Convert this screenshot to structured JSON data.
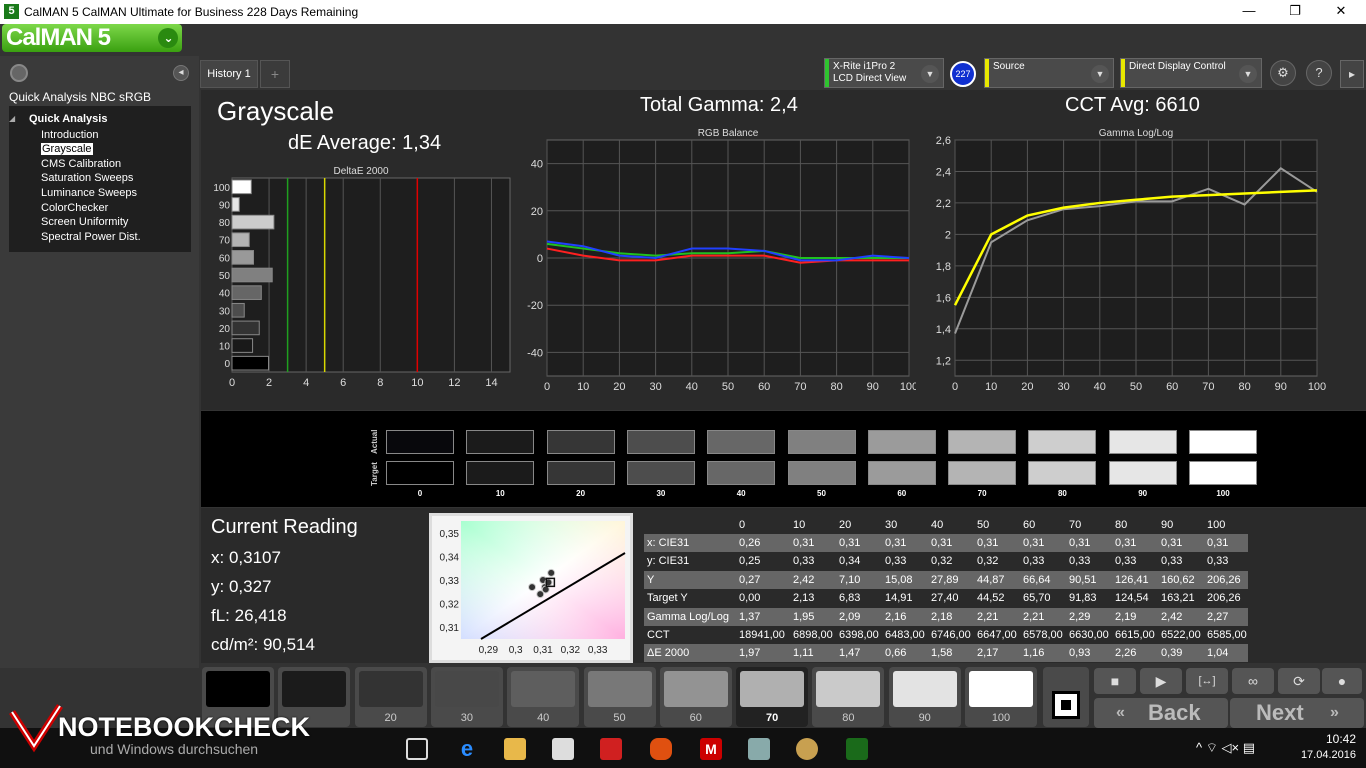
{
  "window": {
    "app_icon": "5",
    "title": "CalMAN 5 CalMAN Ultimate for Business 228 Days Remaining",
    "min": "—",
    "max": "❐",
    "close": "✕"
  },
  "logo": {
    "text": "CalMAN 5",
    "dropdown": "⌄"
  },
  "sidebar": {
    "collapse": "◂",
    "title": "Quick Analysis NBC sRGB",
    "root": "Quick Analysis",
    "items": [
      "Introduction",
      "Grayscale",
      "CMS Calibration",
      "Saturation Sweeps",
      "Luminance Sweeps",
      "ColorChecker",
      "Screen Uniformity",
      "Spectral Power Dist."
    ]
  },
  "tabs": {
    "history": "History 1",
    "add": "+"
  },
  "devices": {
    "meter_line1": "X-Rite i1Pro 2",
    "meter_line2": "LCD Direct View",
    "badge": "227",
    "source": "Source",
    "display": "Direct Display Control",
    "gear": "⚙",
    "help": "?",
    "collapse": "▸"
  },
  "colors": {
    "meter": "#2fc42f",
    "source": "#e8e800",
    "display": "#e8e800",
    "yellow_curve": "#ffff00",
    "gray_curve": "#9a9a9a"
  },
  "header": {
    "title": "Grayscale",
    "de_avg": "dE Average: 1,34",
    "gamma": "Total Gamma: 2,4",
    "cct": "CCT Avg: 6610"
  },
  "chart_data": [
    {
      "type": "bar",
      "title": "DeltaE 2000",
      "orientation": "horizontal",
      "categories": [
        "100",
        "90",
        "80",
        "70",
        "60",
        "50",
        "40",
        "30",
        "20",
        "10",
        "0"
      ],
      "values": [
        1.04,
        0.39,
        2.26,
        0.93,
        1.16,
        2.17,
        1.58,
        0.66,
        1.47,
        1.11,
        1.97
      ],
      "xlim": [
        0,
        15
      ],
      "xticks": [
        "0",
        "2",
        "4",
        "6",
        "8",
        "10",
        "12",
        "14"
      ],
      "threshold_lines": [
        {
          "x": 3,
          "color": "#1fa01f"
        },
        {
          "x": 5,
          "color": "#d8d800"
        },
        {
          "x": 10,
          "color": "#e00000"
        }
      ]
    },
    {
      "type": "line",
      "title": "RGB Balance",
      "x": [
        0,
        10,
        20,
        30,
        40,
        50,
        60,
        70,
        80,
        90,
        100
      ],
      "ylim": [
        -50,
        50
      ],
      "yticks": [
        "40",
        "20",
        "0",
        "-20",
        "-40"
      ],
      "xticks": [
        "0",
        "10",
        "20",
        "30",
        "40",
        "50",
        "60",
        "70",
        "80",
        "90",
        "100"
      ],
      "series": [
        {
          "color": "#ff2020",
          "values": [
            4,
            1,
            -1,
            -1,
            1,
            1,
            1,
            -2,
            -1,
            -1,
            -1
          ]
        },
        {
          "color": "#20c020",
          "values": [
            6,
            4,
            2,
            1,
            2,
            2,
            3,
            0,
            0,
            0,
            0
          ]
        },
        {
          "color": "#2040ff",
          "values": [
            7,
            5,
            1,
            0,
            4,
            4,
            3,
            -1,
            -1,
            1,
            0
          ]
        }
      ]
    },
    {
      "type": "line",
      "title": "Gamma Log/Log",
      "x": [
        0,
        10,
        20,
        30,
        40,
        50,
        60,
        70,
        80,
        90,
        100
      ],
      "ylim": [
        1.1,
        2.6
      ],
      "yticks": [
        "2,6",
        "2,4",
        "2,2",
        "2",
        "1,8",
        "1,6",
        "1,4",
        "1,2"
      ],
      "xticks": [
        "0",
        "10",
        "20",
        "30",
        "40",
        "50",
        "60",
        "70",
        "80",
        "90",
        "100"
      ],
      "series": [
        {
          "color": "#9a9a9a",
          "values": [
            1.37,
            1.95,
            2.09,
            2.16,
            2.18,
            2.21,
            2.21,
            2.29,
            2.19,
            2.42,
            2.27
          ]
        },
        {
          "color": "#ffff00",
          "values": [
            1.55,
            2.0,
            2.12,
            2.17,
            2.2,
            2.22,
            2.24,
            2.25,
            2.26,
            2.27,
            2.28
          ]
        }
      ]
    },
    {
      "type": "scatter",
      "title": "CIE chromaticity",
      "xlim": [
        0.28,
        0.34
      ],
      "ylim": [
        0.305,
        0.355
      ],
      "xticks": [
        "0,29",
        "0,3",
        "0,31",
        "0,32",
        "0,33"
      ],
      "yticks": [
        "0,35",
        "0,34",
        "0,33",
        "0,32",
        "0,31"
      ],
      "points": [
        {
          "x": 0.3107,
          "y": 0.327
        },
        {
          "x": 0.31,
          "y": 0.33
        },
        {
          "x": 0.313,
          "y": 0.333
        },
        {
          "x": 0.306,
          "y": 0.327
        },
        {
          "x": 0.309,
          "y": 0.324
        },
        {
          "x": 0.311,
          "y": 0.326
        },
        {
          "x": 0.312,
          "y": 0.329
        }
      ],
      "target": {
        "x": 0.3127,
        "y": 0.329
      }
    }
  ],
  "swatches": {
    "actual_label": "Actual",
    "target_label": "Target",
    "levels": [
      "0",
      "10",
      "20",
      "30",
      "40",
      "50",
      "60",
      "70",
      "80",
      "90",
      "100"
    ],
    "actual": [
      "#08080c",
      "#1b1b1b",
      "#363636",
      "#4d4d4d",
      "#676767",
      "#808080",
      "#9b9b9b",
      "#b4b4b4",
      "#cecece",
      "#e6e6e6",
      "#ffffff"
    ],
    "target": [
      "#000000",
      "#1b1b1b",
      "#363636",
      "#4d4d4d",
      "#676767",
      "#808080",
      "#9b9b9b",
      "#b4b4b4",
      "#cecece",
      "#e6e6e6",
      "#ffffff"
    ]
  },
  "reading": {
    "title": "Current Reading",
    "x": "x: 0,3107",
    "y": "y: 0,327",
    "fl": "fL: 26,418",
    "cdm": "cd/m²: 90,514"
  },
  "table": {
    "header": [
      "",
      "0",
      "10",
      "20",
      "30",
      "40",
      "50",
      "60",
      "70",
      "80",
      "90",
      "100"
    ],
    "rows": [
      [
        "x: CIE31",
        "0,26",
        "0,31",
        "0,31",
        "0,31",
        "0,31",
        "0,31",
        "0,31",
        "0,31",
        "0,31",
        "0,31",
        "0,31"
      ],
      [
        "y: CIE31",
        "0,25",
        "0,33",
        "0,34",
        "0,33",
        "0,32",
        "0,32",
        "0,33",
        "0,33",
        "0,33",
        "0,33",
        "0,33"
      ],
      [
        "Y",
        "0,27",
        "2,42",
        "7,10",
        "15,08",
        "27,89",
        "44,87",
        "66,64",
        "90,51",
        "126,41",
        "160,62",
        "206,26"
      ],
      [
        "Target Y",
        "0,00",
        "2,13",
        "6,83",
        "14,91",
        "27,40",
        "44,52",
        "65,70",
        "91,83",
        "124,54",
        "163,21",
        "206,26"
      ],
      [
        "Gamma Log/Log",
        "1,37",
        "1,95",
        "2,09",
        "2,16",
        "2,18",
        "2,21",
        "2,21",
        "2,29",
        "2,19",
        "2,42",
        "2,27"
      ],
      [
        "CCT",
        "18941,00",
        "6898,00",
        "6398,00",
        "6483,00",
        "6746,00",
        "6647,00",
        "6578,00",
        "6630,00",
        "6615,00",
        "6522,00",
        "6585,00"
      ],
      [
        "ΔE 2000",
        "1,97",
        "1,11",
        "1,47",
        "0,66",
        "1,58",
        "2,17",
        "1,16",
        "0,93",
        "2,26",
        "0,39",
        "1,04"
      ]
    ]
  },
  "bottom_patches": {
    "labels": [
      "",
      "",
      "20",
      "30",
      "40",
      "50",
      "60",
      "70",
      "80",
      "90",
      "100"
    ],
    "colors": [
      "#000000",
      "#1b1b1b",
      "#333333",
      "#484848",
      "#5e5e5e",
      "#787878",
      "#939393",
      "#b0b0b0",
      "#cacaca",
      "#e3e3e3",
      "#ffffff"
    ],
    "selected": "70"
  },
  "controls": {
    "stop": "■",
    "play": "▶",
    "fit": "[↔]",
    "loop": "∞",
    "refresh": "⟳",
    "back": "Back",
    "next": "Next",
    "back_arrow": "«",
    "next_arrow": "»"
  },
  "watermark": {
    "brand": "NOTEBOOKCHECK",
    "search": "und Windows durchsuchen"
  },
  "taskbar": {
    "time": "10:42",
    "date": "17.04.2016",
    "tray": "^  ⌔  ◁×  ▤"
  }
}
